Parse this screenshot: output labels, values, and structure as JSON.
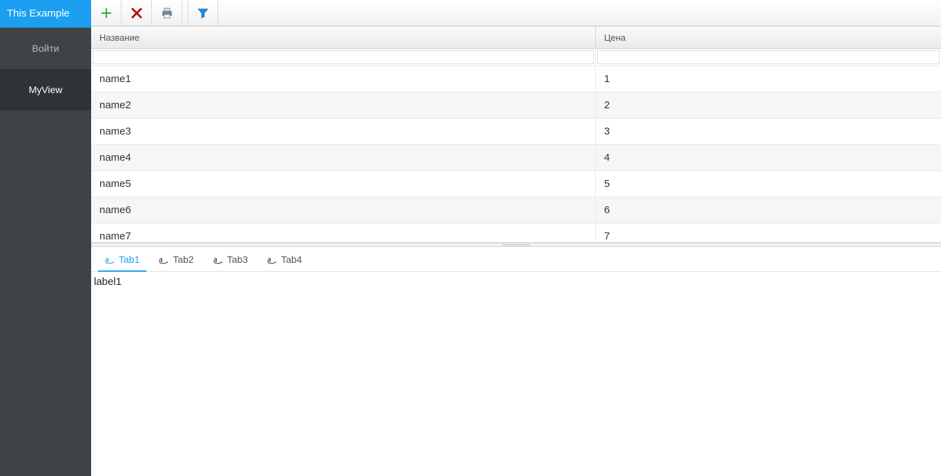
{
  "sidebar": {
    "title": "This Example",
    "items": [
      {
        "label": "Войти",
        "active": false
      },
      {
        "label": "MyView",
        "active": true
      }
    ]
  },
  "toolbar": {
    "buttons": [
      {
        "name": "add-button",
        "icon": "plus-icon"
      },
      {
        "name": "delete-button",
        "icon": "delete-icon"
      },
      {
        "name": "print-button",
        "icon": "printer-icon"
      },
      {
        "name": "filter-button",
        "icon": "filter-icon",
        "separatedLeft": true
      }
    ]
  },
  "grid": {
    "columns": [
      {
        "key": "name",
        "label": "Название"
      },
      {
        "key": "price",
        "label": "Цена"
      }
    ],
    "filter": {
      "name": "",
      "price": ""
    },
    "rows": [
      {
        "name": "name1",
        "price": "1"
      },
      {
        "name": "name2",
        "price": "2"
      },
      {
        "name": "name3",
        "price": "3"
      },
      {
        "name": "name4",
        "price": "4"
      },
      {
        "name": "name5",
        "price": "5"
      },
      {
        "name": "name6",
        "price": "6"
      },
      {
        "name": "name7",
        "price": "7"
      }
    ]
  },
  "tabs": {
    "items": [
      {
        "label": "Tab1",
        "active": true
      },
      {
        "label": "Tab2",
        "active": false
      },
      {
        "label": "Tab3",
        "active": false
      },
      {
        "label": "Tab4",
        "active": false
      }
    ],
    "content": "label1"
  }
}
